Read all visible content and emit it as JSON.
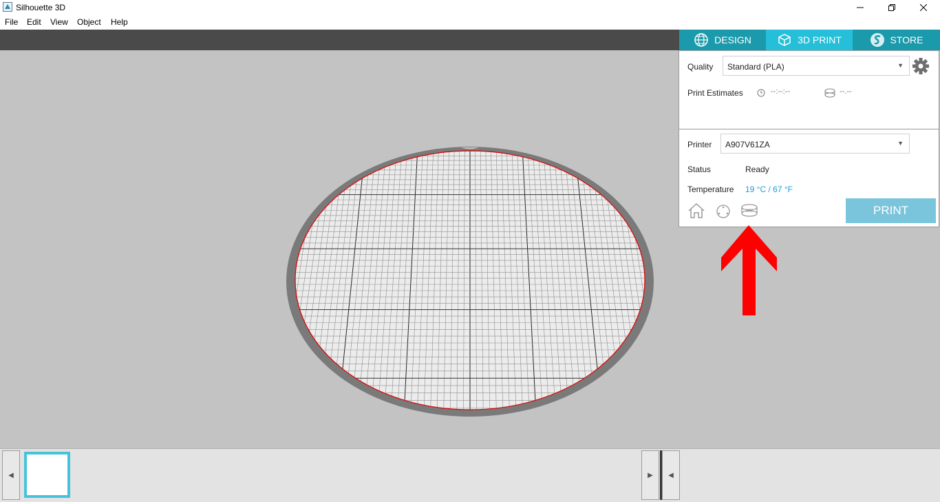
{
  "window": {
    "title": "Silhouette 3D"
  },
  "menu": [
    "File",
    "Edit",
    "View",
    "Object",
    "Help"
  ],
  "tabs": [
    {
      "label": "DESIGN",
      "icon": "globe-icon"
    },
    {
      "label": "3D PRINT",
      "icon": "3d-box-icon"
    },
    {
      "label": "STORE",
      "icon": "silhouette-s-icon"
    }
  ],
  "quality": {
    "label": "Quality",
    "value": "Standard (PLA)"
  },
  "estimates": {
    "label": "Print Estimates",
    "time": "--:--:--",
    "material": "--.--"
  },
  "printer": {
    "label": "Printer",
    "value": "A907V61ZA",
    "status_label": "Status",
    "status_value": "Ready",
    "temp_label": "Temperature",
    "temp_value": "19 °C / 67 °F"
  },
  "actions": {
    "print_label": "PRINT"
  },
  "colors": {
    "accent": "#25bfd9",
    "tab_inactive": "#1a9aab",
    "print_button": "#7ac5db",
    "temperature": "#1a9ed8",
    "annotation_arrow": "#ff0000",
    "bed_outline": "#e00000"
  }
}
